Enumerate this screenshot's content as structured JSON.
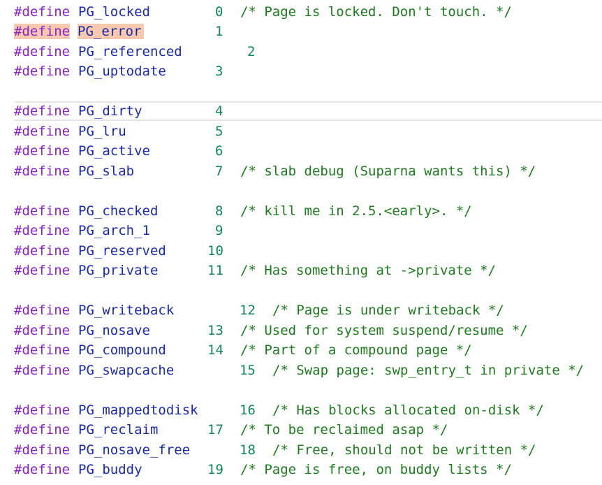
{
  "keyword": "#define",
  "lines": [
    {
      "name": "PG_locked",
      "num": "0",
      "comment": "/* Page is locked. Don't touch. */"
    },
    {
      "name": "PG_error",
      "num": "1",
      "comment": ""
    },
    {
      "name": "PG_referenced",
      "num": "2",
      "comment": ""
    },
    {
      "name": "PG_uptodate",
      "num": "3",
      "comment": ""
    },
    {
      "name": "PG_dirty",
      "num": "4",
      "comment": ""
    },
    {
      "name": "PG_lru",
      "num": "5",
      "comment": ""
    },
    {
      "name": "PG_active",
      "num": "6",
      "comment": ""
    },
    {
      "name": "PG_slab",
      "num": "7",
      "comment": "/* slab debug (Suparna wants this) */"
    },
    {
      "name": "PG_checked",
      "num": "8",
      "comment": "/* kill me in 2.5.<early>. */"
    },
    {
      "name": "PG_arch_1",
      "num": "9",
      "comment": ""
    },
    {
      "name": "PG_reserved",
      "num": "10",
      "comment": ""
    },
    {
      "name": "PG_private",
      "num": "11",
      "comment": "/* Has something at ->private */"
    },
    {
      "name": "PG_writeback",
      "num": "12",
      "comment": "/* Page is under writeback */"
    },
    {
      "name": "PG_nosave",
      "num": "13",
      "comment": "/* Used for system suspend/resume */"
    },
    {
      "name": "PG_compound",
      "num": "14",
      "comment": "/* Part of a compound page */"
    },
    {
      "name": "PG_swapcache",
      "num": "15",
      "comment": "/* Swap page: swp_entry_t in private */"
    },
    {
      "name": "PG_mappedtodisk",
      "num": "16",
      "comment": "/* Has blocks allocated on-disk */"
    },
    {
      "name": "PG_reclaim",
      "num": "17",
      "comment": "/* To be reclaimed asap */"
    },
    {
      "name": "PG_nosave_free",
      "num": "18",
      "comment": "/* Free, should not be written */"
    },
    {
      "name": "PG_buddy",
      "num": "19",
      "comment": "/* Page is free, on buddy lists */"
    }
  ]
}
